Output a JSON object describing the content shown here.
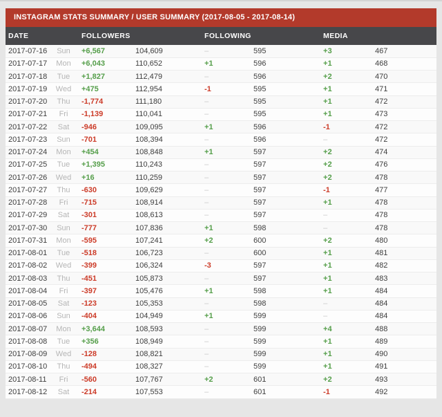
{
  "header": {
    "title": "INSTAGRAM STATS SUMMARY / USER SUMMARY (2017-08-05 - 2017-08-14)"
  },
  "columns": {
    "date": "DATE",
    "followers": "FOLLOWERS",
    "following": "FOLLOWING",
    "media": "MEDIA"
  },
  "colors": {
    "accent": "#b33a2b",
    "header_bg": "#47474a",
    "page_bg": "#e6e6e6",
    "positive": "#559e4a",
    "negative": "#cc3b28",
    "muted_day": "#b5b5b5",
    "dash": "#c9c9c9",
    "text": "#3d3d3d"
  },
  "row_fields": [
    "date",
    "day",
    "followers_change",
    "followers",
    "following_change",
    "following",
    "media_change",
    "media"
  ],
  "rows": [
    {
      "date": "2017-07-16",
      "day": "Sun",
      "followers_change": "+6,567",
      "followers": "104,609",
      "following_change": "–",
      "following": "595",
      "media_change": "+3",
      "media": "467"
    },
    {
      "date": "2017-07-17",
      "day": "Mon",
      "followers_change": "+6,043",
      "followers": "110,652",
      "following_change": "+1",
      "following": "596",
      "media_change": "+1",
      "media": "468"
    },
    {
      "date": "2017-07-18",
      "day": "Tue",
      "followers_change": "+1,827",
      "followers": "112,479",
      "following_change": "–",
      "following": "596",
      "media_change": "+2",
      "media": "470"
    },
    {
      "date": "2017-07-19",
      "day": "Wed",
      "followers_change": "+475",
      "followers": "112,954",
      "following_change": "-1",
      "following": "595",
      "media_change": "+1",
      "media": "471"
    },
    {
      "date": "2017-07-20",
      "day": "Thu",
      "followers_change": "-1,774",
      "followers": "111,180",
      "following_change": "–",
      "following": "595",
      "media_change": "+1",
      "media": "472"
    },
    {
      "date": "2017-07-21",
      "day": "Fri",
      "followers_change": "-1,139",
      "followers": "110,041",
      "following_change": "–",
      "following": "595",
      "media_change": "+1",
      "media": "473"
    },
    {
      "date": "2017-07-22",
      "day": "Sat",
      "followers_change": "-946",
      "followers": "109,095",
      "following_change": "+1",
      "following": "596",
      "media_change": "-1",
      "media": "472"
    },
    {
      "date": "2017-07-23",
      "day": "Sun",
      "followers_change": "-701",
      "followers": "108,394",
      "following_change": "–",
      "following": "596",
      "media_change": "–",
      "media": "472"
    },
    {
      "date": "2017-07-24",
      "day": "Mon",
      "followers_change": "+454",
      "followers": "108,848",
      "following_change": "+1",
      "following": "597",
      "media_change": "+2",
      "media": "474"
    },
    {
      "date": "2017-07-25",
      "day": "Tue",
      "followers_change": "+1,395",
      "followers": "110,243",
      "following_change": "–",
      "following": "597",
      "media_change": "+2",
      "media": "476"
    },
    {
      "date": "2017-07-26",
      "day": "Wed",
      "followers_change": "+16",
      "followers": "110,259",
      "following_change": "–",
      "following": "597",
      "media_change": "+2",
      "media": "478"
    },
    {
      "date": "2017-07-27",
      "day": "Thu",
      "followers_change": "-630",
      "followers": "109,629",
      "following_change": "–",
      "following": "597",
      "media_change": "-1",
      "media": "477"
    },
    {
      "date": "2017-07-28",
      "day": "Fri",
      "followers_change": "-715",
      "followers": "108,914",
      "following_change": "–",
      "following": "597",
      "media_change": "+1",
      "media": "478"
    },
    {
      "date": "2017-07-29",
      "day": "Sat",
      "followers_change": "-301",
      "followers": "108,613",
      "following_change": "–",
      "following": "597",
      "media_change": "–",
      "media": "478"
    },
    {
      "date": "2017-07-30",
      "day": "Sun",
      "followers_change": "-777",
      "followers": "107,836",
      "following_change": "+1",
      "following": "598",
      "media_change": "–",
      "media": "478"
    },
    {
      "date": "2017-07-31",
      "day": "Mon",
      "followers_change": "-595",
      "followers": "107,241",
      "following_change": "+2",
      "following": "600",
      "media_change": "+2",
      "media": "480"
    },
    {
      "date": "2017-08-01",
      "day": "Tue",
      "followers_change": "-518",
      "followers": "106,723",
      "following_change": "–",
      "following": "600",
      "media_change": "+1",
      "media": "481"
    },
    {
      "date": "2017-08-02",
      "day": "Wed",
      "followers_change": "-399",
      "followers": "106,324",
      "following_change": "-3",
      "following": "597",
      "media_change": "+1",
      "media": "482"
    },
    {
      "date": "2017-08-03",
      "day": "Thu",
      "followers_change": "-451",
      "followers": "105,873",
      "following_change": "–",
      "following": "597",
      "media_change": "+1",
      "media": "483"
    },
    {
      "date": "2017-08-04",
      "day": "Fri",
      "followers_change": "-397",
      "followers": "105,476",
      "following_change": "+1",
      "following": "598",
      "media_change": "+1",
      "media": "484"
    },
    {
      "date": "2017-08-05",
      "day": "Sat",
      "followers_change": "-123",
      "followers": "105,353",
      "following_change": "–",
      "following": "598",
      "media_change": "–",
      "media": "484"
    },
    {
      "date": "2017-08-06",
      "day": "Sun",
      "followers_change": "-404",
      "followers": "104,949",
      "following_change": "+1",
      "following": "599",
      "media_change": "–",
      "media": "484"
    },
    {
      "date": "2017-08-07",
      "day": "Mon",
      "followers_change": "+3,644",
      "followers": "108,593",
      "following_change": "–",
      "following": "599",
      "media_change": "+4",
      "media": "488"
    },
    {
      "date": "2017-08-08",
      "day": "Tue",
      "followers_change": "+356",
      "followers": "108,949",
      "following_change": "–",
      "following": "599",
      "media_change": "+1",
      "media": "489"
    },
    {
      "date": "2017-08-09",
      "day": "Wed",
      "followers_change": "-128",
      "followers": "108,821",
      "following_change": "–",
      "following": "599",
      "media_change": "+1",
      "media": "490"
    },
    {
      "date": "2017-08-10",
      "day": "Thu",
      "followers_change": "-494",
      "followers": "108,327",
      "following_change": "–",
      "following": "599",
      "media_change": "+1",
      "media": "491"
    },
    {
      "date": "2017-08-11",
      "day": "Fri",
      "followers_change": "-560",
      "followers": "107,767",
      "following_change": "+2",
      "following": "601",
      "media_change": "+2",
      "media": "493"
    },
    {
      "date": "2017-08-12",
      "day": "Sat",
      "followers_change": "-214",
      "followers": "107,553",
      "following_change": "–",
      "following": "601",
      "media_change": "-1",
      "media": "492"
    }
  ]
}
